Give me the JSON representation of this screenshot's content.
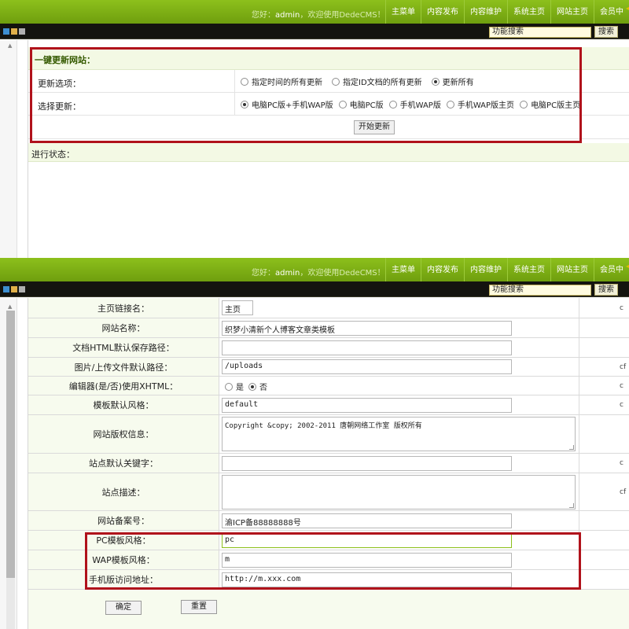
{
  "header": {
    "greeting_prefix": "您好：",
    "user": "admin",
    "greeting_suffix": "，欢迎使用DedeCMS！",
    "nav": [
      "主菜单",
      "内容发布",
      "内容维护",
      "系统主页",
      "网站主页",
      "会员中"
    ]
  },
  "search": {
    "value": "功能搜索",
    "button": "搜索"
  },
  "update_panel": {
    "title": "一键更新网站：",
    "rows": [
      {
        "label": "更新选项：",
        "options": [
          {
            "label": "指定时间的所有更新",
            "checked": false
          },
          {
            "label": "指定ID文档的所有更新",
            "checked": false
          },
          {
            "label": "更新所有",
            "checked": true
          }
        ]
      },
      {
        "label": "选择更新：",
        "options": [
          {
            "label": "电脑PC版+手机WAP版",
            "checked": true
          },
          {
            "label": "电脑PC版",
            "checked": false
          },
          {
            "label": "手机WAP版",
            "checked": false
          },
          {
            "label": "手机WAP版主页",
            "checked": false
          },
          {
            "label": "电脑PC版主页",
            "checked": false
          }
        ]
      }
    ],
    "start_button": "开始更新",
    "status_label": "进行状态："
  },
  "settings_form": {
    "rows": [
      {
        "label": "主页链接名：",
        "value": "主页",
        "cut": "c"
      },
      {
        "label": "网站名称：",
        "value": "织梦小清新个人博客文章类模板",
        "cut": ""
      },
      {
        "label": "文档HTML默认保存路径：",
        "value": "",
        "cut": ""
      },
      {
        "label": "图片/上传文件默认路径：",
        "value": "/uploads",
        "cut": "cf"
      },
      {
        "label": "编辑器(是/否)使用XHTML：",
        "radio_yes": "是",
        "radio_no": "否",
        "selected": "否",
        "cut": "c"
      },
      {
        "label": "模板默认风格：",
        "value": "default",
        "cut": "c"
      },
      {
        "label": "网站版权信息：",
        "value": "Copyright &copy; 2002-2011 唐朝网络工作室 版权所有",
        "cut": ""
      },
      {
        "label": "站点默认关键字：",
        "value": "",
        "cut": "c"
      },
      {
        "label": "站点描述：",
        "value": "",
        "cut": "cf"
      },
      {
        "label": "网站备案号：",
        "value": "渝ICP备88888888号",
        "cut": ""
      },
      {
        "label": "PC模板风格：",
        "value": "pc",
        "cut": ""
      },
      {
        "label": "WAP模板风格：",
        "value": "m",
        "cut": ""
      },
      {
        "label": "手机版访问地址：",
        "value": "http://m.xxx.com",
        "cut": ""
      }
    ],
    "confirm_button": "确定",
    "reset_button": "重置"
  },
  "colors": {
    "header_green": "#7bad14",
    "highlight_red": "#b0121b",
    "label_bg": "#f7fbee"
  },
  "icons": [
    "window-button-icon",
    "dropdown-arrow-icon",
    "radio-icon",
    "resize-grip-icon"
  ]
}
